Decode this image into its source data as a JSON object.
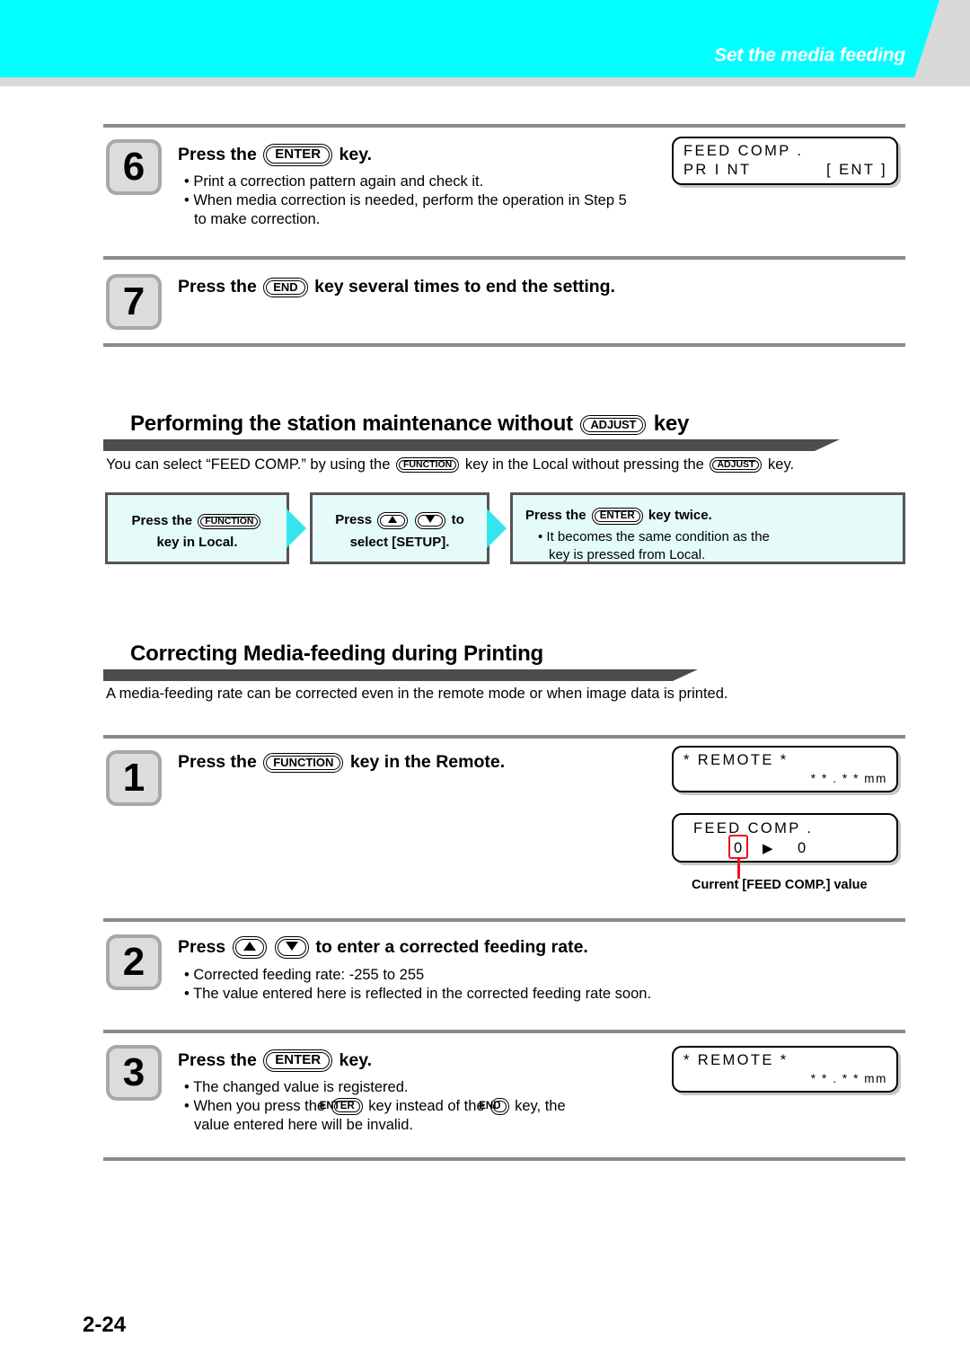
{
  "header": {
    "title": "Set the media feeding",
    "cyan": "#00ffff",
    "band": "#d8d8d8"
  },
  "page_number": "2-24",
  "keys": {
    "enter": "ENTER",
    "end": "END",
    "adjust": "ADJUST",
    "function": "FUNCTION",
    "up": "up-arrow",
    "down": "down-arrow"
  },
  "steps": [
    {
      "number": "6",
      "head_pre": "Press the",
      "head_key": "ENTER",
      "head_post": "key.",
      "bullets": [
        "• Print a correction pattern again and check it.",
        "• When media correction is needed, perform the operation in Step 5",
        "to make correction."
      ]
    },
    {
      "number": "7",
      "head_pre": "Press the",
      "head_key": "END",
      "head_post": "key several times to end the setting.",
      "bullets": []
    },
    {
      "number": "1",
      "head_pre": "Press the",
      "head_key": "FUNCTION",
      "head_post": "key in the Remote.",
      "bullets": []
    },
    {
      "number": "2",
      "head_pre": "Press",
      "head_post": "to enter a corrected feeding rate.",
      "bullets": [
        "• Corrected feeding rate: -255 to 255",
        "• The value entered here is reflected in the corrected feeding rate soon."
      ]
    },
    {
      "number": "3",
      "head_pre": "Press the",
      "head_key": "ENTER",
      "head_post": "key.",
      "bullets": [
        "• The changed value is registered.",
        "• When you press the",
        "key instead of the",
        "key, the",
        "value entered here will be invalid."
      ]
    }
  ],
  "lcd": {
    "step6": {
      "line1": "FEED  COMP .",
      "line2a": "PR I NT",
      "line2b": "[ ENT ]"
    },
    "step1a": {
      "line1": "* REMOTE *",
      "line2": "* * . * * mm"
    },
    "step1b": {
      "line1": "FEED  COMP .",
      "value_current": "0",
      "value_new": "0"
    },
    "step3": {
      "line1": "* REMOTE *",
      "line2": "* * . * * mm"
    }
  },
  "callout": {
    "text": "Current [FEED COMP.] value",
    "color": "#e8151c"
  },
  "section_adjust": {
    "title_pre": "Performing the station maintenance without",
    "title_key": "ADJUST",
    "title_post": "key",
    "para_a": "You can select “FEED COMP.” by using the",
    "para_b": "key in the Local without pressing the",
    "para_c": "key."
  },
  "flow": [
    {
      "line1_pre": "Press the",
      "line1_key": "FUNCTION",
      "line2": "key in Local."
    },
    {
      "line1_pre": "Press",
      "line1_post": "to",
      "line2": "select [SETUP]."
    },
    {
      "line1_pre": "Press the",
      "line1_key": "ENTER",
      "line1_post": "key twice.",
      "line2": "• It becomes the same condition as the",
      "line3": "key is pressed from Local."
    }
  ],
  "section_correct": {
    "title": "Correcting Media-feeding during Printing",
    "para": "A media-feeding rate can be corrected even in the remote mode or when image data is printed."
  }
}
